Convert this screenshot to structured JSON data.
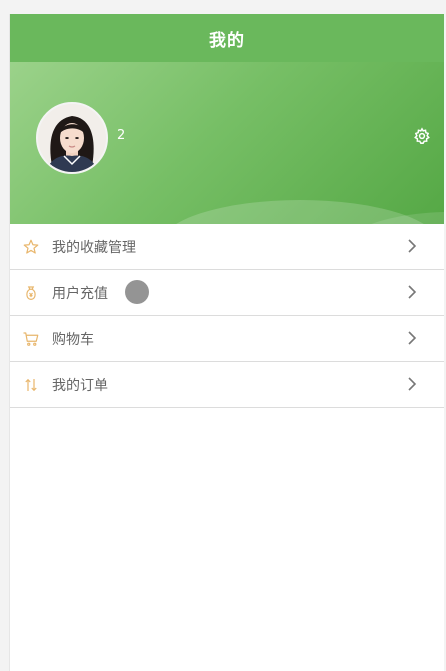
{
  "header": {
    "title": "我的"
  },
  "profile": {
    "username": "2",
    "avatar_icon": "avatar-photo",
    "settings_icon": "gear-icon"
  },
  "menu": {
    "items": [
      {
        "label": "我的收藏管理",
        "icon": "star-icon"
      },
      {
        "label": "用户充值",
        "icon": "money-bag-icon"
      },
      {
        "label": "购物车",
        "icon": "cart-icon"
      },
      {
        "label": "我的订单",
        "icon": "sort-arrows-icon"
      }
    ]
  },
  "colors": {
    "header_green": "#6ab85c",
    "gradient_light": "#9bd28a",
    "gradient_dark": "#55a845",
    "icon_accent": "#e8b66c",
    "label_gray": "#666666"
  }
}
